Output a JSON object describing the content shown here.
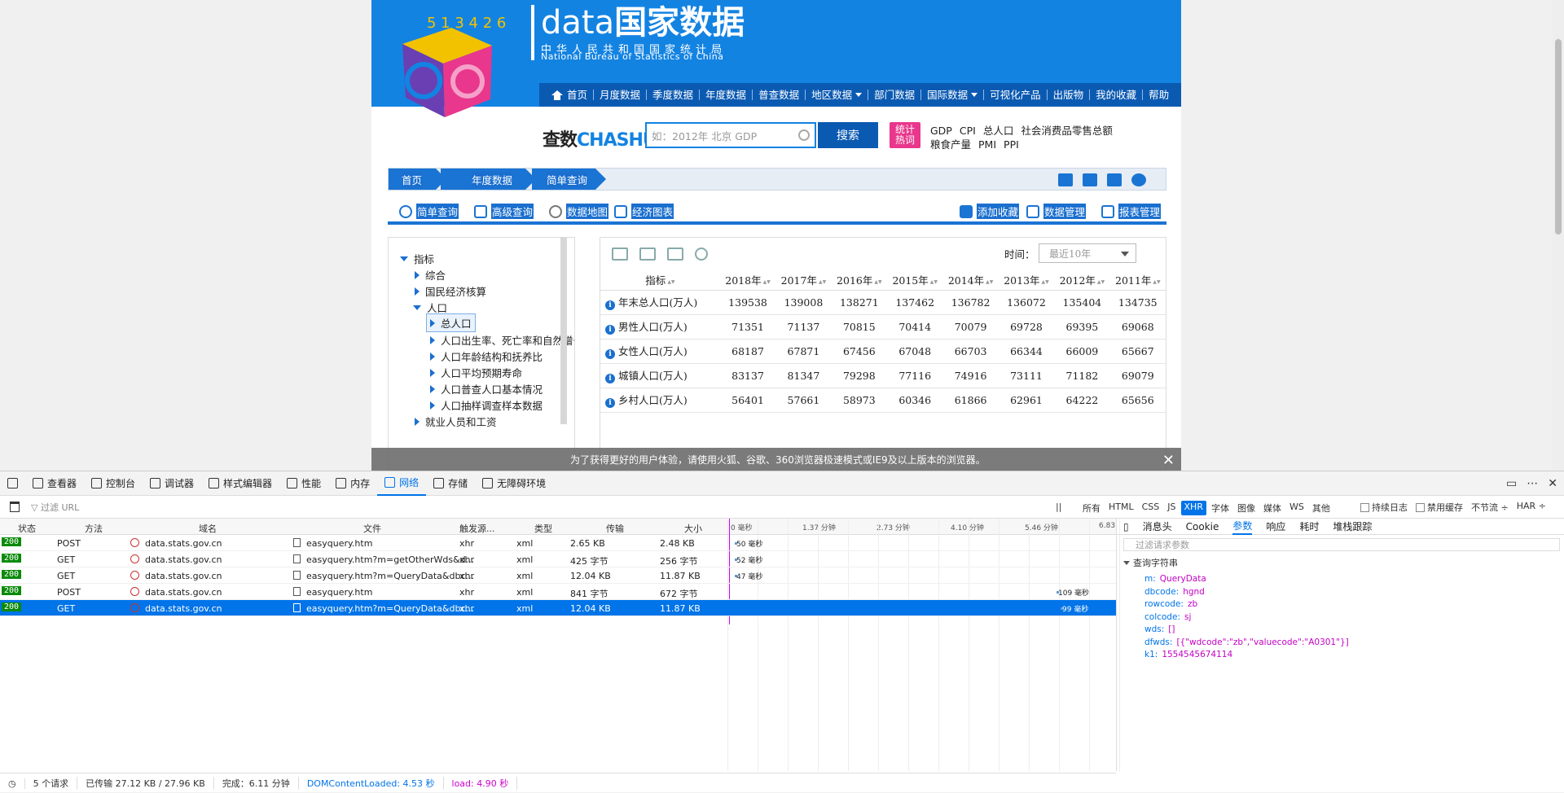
{
  "site": {
    "brand_en": "data",
    "brand_cn": "国家数据",
    "org_cn": "中华人民共和国国家统计局",
    "org_en": "National Bureau of Statistics of China",
    "logo_digits": "5 1 3 4 2 6",
    "nav": [
      "首页",
      "月度数据",
      "季度数据",
      "年度数据",
      "普查数据",
      "地区数据",
      "部门数据",
      "国际数据",
      "可视化产品",
      "出版物",
      "我的收藏",
      "帮助"
    ],
    "chashu_cn": "查数",
    "chashu_en": "CHASHU",
    "search_placeholder": "如：2012年 北京 GDP",
    "search_button": "搜索",
    "hot_badge_1": "统计",
    "hot_badge_2": "热词",
    "hot_links": [
      "GDP",
      "CPI",
      "总人口",
      "社会消费品零售总额",
      "粮食产量",
      "PMI",
      "PPI"
    ],
    "breadcrumb": [
      "首页",
      "年度数据",
      "简单查询"
    ],
    "tools_left": [
      "简单查询",
      "高级查询",
      "数据地图",
      "经济图表"
    ],
    "tools_right": [
      "添加收藏",
      "数据管理",
      "报表管理"
    ],
    "tree": {
      "root": "指标",
      "items": [
        "综合",
        "国民经济核算",
        "人口"
      ],
      "children": [
        "总人口",
        "人口出生率、死亡率和自然增长",
        "人口年龄结构和抚养比",
        "人口平均预期寿命",
        "人口普查人口基本情况",
        "人口抽样调查样本数据"
      ],
      "after": [
        "就业人员和工资"
      ]
    },
    "time_label": "时间：",
    "time_select": "最近10年",
    "table": {
      "header": [
        "指标",
        "2018年",
        "2017年",
        "2016年",
        "2015年",
        "2014年",
        "2013年",
        "2012年",
        "2011年"
      ],
      "rows": [
        [
          "年末总人口(万人)",
          "139538",
          "139008",
          "138271",
          "137462",
          "136782",
          "136072",
          "135404",
          "134735"
        ],
        [
          "男性人口(万人)",
          "71351",
          "71137",
          "70815",
          "70414",
          "70079",
          "69728",
          "69395",
          "69068"
        ],
        [
          "女性人口(万人)",
          "68187",
          "67871",
          "67456",
          "67048",
          "66703",
          "66344",
          "66009",
          "65667"
        ],
        [
          "城镇人口(万人)",
          "83137",
          "81347",
          "79298",
          "77116",
          "74916",
          "73111",
          "71182",
          "69079"
        ],
        [
          "乡村人口(万人)",
          "56401",
          "57661",
          "58973",
          "60346",
          "61866",
          "62961",
          "64222",
          "65656"
        ]
      ]
    },
    "notice": "为了获得更好的用户体验，请使用火狐、谷歌、360浏览器极速模式或IE9及以上版本的浏览器。",
    "notice_close": "✕"
  },
  "devtools": {
    "tabs": [
      "查看器",
      "控制台",
      "调试器",
      "样式编辑器",
      "性能",
      "内存",
      "网络",
      "存储",
      "无障碍环境"
    ],
    "filter_placeholder": "过滤 URL",
    "pause": "||",
    "type_filters": [
      "所有",
      "HTML",
      "CSS",
      "JS",
      "XHR",
      "字体",
      "图像",
      "媒体",
      "WS",
      "其他"
    ],
    "options": [
      "持续日志",
      "禁用缓存",
      "不节流 ÷",
      "HAR ÷"
    ],
    "columns": [
      "状态",
      "方法",
      "域名",
      "文件",
      "触发源...",
      "类型",
      "传输",
      "大小"
    ],
    "timeline_ticks": [
      "0 毫秒",
      "1.37 分钟",
      "2.73 分钟",
      "4.10 分钟",
      "5.46 分钟",
      "6.83"
    ],
    "requests": [
      {
        "status": "200",
        "method": "POST",
        "domain": "data.stats.gov.cn",
        "file": "easyquery.htm",
        "cause": "xhr",
        "type": "xml",
        "transferred": "2.65 KB",
        "size": "2.48 KB",
        "time": "50 毫秒"
      },
      {
        "status": "200",
        "method": "GET",
        "domain": "data.stats.gov.cn",
        "file": "easyquery.htm?m=getOtherWds&d...",
        "cause": "xhr",
        "type": "xml",
        "transferred": "425 字节",
        "size": "256 字节",
        "time": "52 毫秒"
      },
      {
        "status": "200",
        "method": "GET",
        "domain": "data.stats.gov.cn",
        "file": "easyquery.htm?m=QueryData&dbc...",
        "cause": "xhr",
        "type": "xml",
        "transferred": "12.04 KB",
        "size": "11.87 KB",
        "time": "47 毫秒"
      },
      {
        "status": "200",
        "method": "POST",
        "domain": "data.stats.gov.cn",
        "file": "easyquery.htm",
        "cause": "xhr",
        "type": "xml",
        "transferred": "841 字节",
        "size": "672 字节",
        "time": "109 毫秒"
      },
      {
        "status": "200",
        "method": "GET",
        "domain": "data.stats.gov.cn",
        "file": "easyquery.htm?m=QueryData&dbc...",
        "cause": "xhr",
        "type": "xml",
        "transferred": "12.04 KB",
        "size": "11.87 KB",
        "time": "99 毫秒"
      }
    ],
    "detail_tabs": [
      "消息头",
      "Cookie",
      "参数",
      "响应",
      "耗时",
      "堆栈跟踪"
    ],
    "detail_filter": "过滤请求参数",
    "query_heading": "查询字符串",
    "params": [
      {
        "k": "m:",
        "v": "QueryData"
      },
      {
        "k": "dbcode:",
        "v": "hgnd"
      },
      {
        "k": "rowcode:",
        "v": "zb"
      },
      {
        "k": "colcode:",
        "v": "sj"
      },
      {
        "k": "wds:",
        "v": "[]"
      },
      {
        "k": "dfwds:",
        "v": "[{\"wdcode\":\"zb\",\"valuecode\":\"A0301\"}]"
      },
      {
        "k": "k1:",
        "v": "1554545674114"
      }
    ],
    "status": {
      "requests": "5 个请求",
      "transferred": "已传输 27.12 KB / 27.96 KB",
      "finish": "完成：6.11 分钟",
      "dcl": "DOMContentLoaded: 4.53 秒",
      "load": "load: 4.90 秒"
    }
  }
}
